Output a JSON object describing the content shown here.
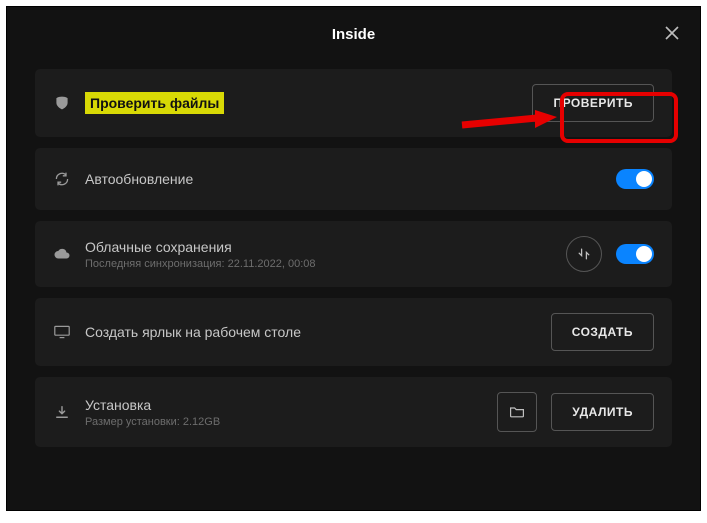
{
  "header": {
    "title": "Inside"
  },
  "rows": {
    "verify": {
      "label": "Проверить файлы",
      "button": "ПРОВЕРИТЬ"
    },
    "autoupdate": {
      "label": "Автообновление"
    },
    "cloud": {
      "label": "Облачные сохранения",
      "sub": "Последняя синхронизация: 22.11.2022, 00:08"
    },
    "shortcut": {
      "label": "Создать ярлык на рабочем столе",
      "button": "СОЗДАТЬ"
    },
    "install": {
      "label": "Установка",
      "sub": "Размер установки: 2.12GB",
      "button": "УДАЛИТЬ"
    }
  }
}
